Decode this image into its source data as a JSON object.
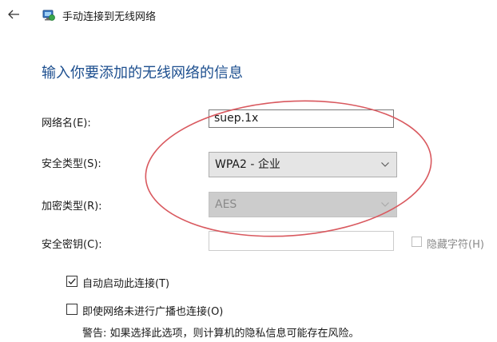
{
  "header": {
    "back_icon": "back-arrow-icon",
    "network_icon": "wireless-network-icon",
    "title": "手动连接到无线网络"
  },
  "heading": "输入你要添加的无线网络的信息",
  "form": {
    "network_name": {
      "label": "网络名(E):",
      "value": "suep.1x"
    },
    "security_type": {
      "label": "安全类型(S):",
      "value": "WPA2 - 企业"
    },
    "encryption_type": {
      "label": "加密类型(R):",
      "value": "AES",
      "enabled": false
    },
    "security_key": {
      "label": "安全密钥(C):",
      "value": "",
      "enabled": false
    },
    "hide_chars": {
      "label": "隐藏字符(H)",
      "checked": false,
      "enabled": false
    }
  },
  "options": {
    "auto_start": {
      "label": "自动启动此连接(T)",
      "checked": true
    },
    "connect_hidden": {
      "label": "即使网络未进行广播也连接(O)",
      "checked": false
    },
    "warning": "警告: 如果选择此选项，则计算机的隐私信息可能存在风险。"
  },
  "colors": {
    "heading": "#1d4f8f",
    "annotation": "#d9595f",
    "disabled_fill": "#cccccc"
  }
}
